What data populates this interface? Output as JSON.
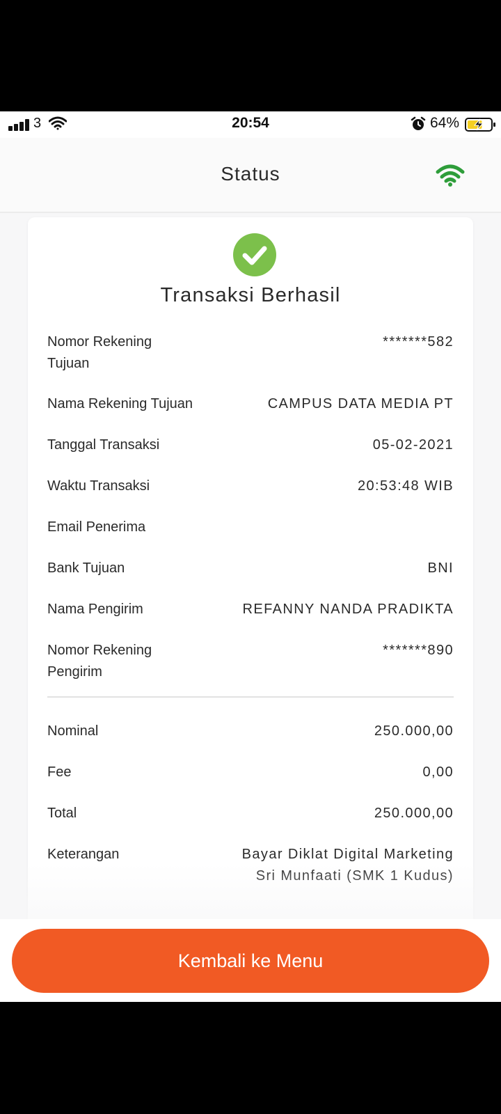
{
  "status_bar": {
    "carrier": "3",
    "time": "20:54",
    "battery_percent": "64%",
    "battery_level": 0.64,
    "signal_icon": "signal-bars-icon",
    "wifi_icon": "wifi-icon",
    "alarm_icon": "alarm-clock-icon",
    "battery_icon": "battery-charging-icon"
  },
  "header": {
    "title": "Status",
    "connection_icon": "wifi-icon",
    "connection_color": "#2e9d3a"
  },
  "card": {
    "status_icon": "check-circle-icon",
    "status_color": "#7cc04b",
    "title": "Transaksi Berhasil",
    "details": [
      {
        "label": "Nomor Rekening Tujuan",
        "value": "*******582"
      },
      {
        "label": "Nama Rekening Tujuan",
        "value": "CAMPUS DATA MEDIA PT"
      },
      {
        "label": "Tanggal Transaksi",
        "value": "05-02-2021"
      },
      {
        "label": "Waktu Transaksi",
        "value": "20:53:48 WIB"
      },
      {
        "label": "Email Penerima",
        "value": ""
      },
      {
        "label": "Bank Tujuan",
        "value": "BNI"
      },
      {
        "label": "Nama Pengirim",
        "value": "REFANNY NANDA PRADIKTA"
      },
      {
        "label": "Nomor Rekening Pengirim",
        "value": "*******890"
      }
    ],
    "amounts": [
      {
        "label": "Nominal",
        "value": "250.000,00"
      },
      {
        "label": "Fee",
        "value": "0,00"
      },
      {
        "label": "Total",
        "value": "250.000,00"
      },
      {
        "label": "Keterangan",
        "value": "Bayar Diklat Digital Marketing Sri Munfaati (SMK 1 Kudus)"
      }
    ]
  },
  "footer": {
    "button_label": "Kembali ke Menu",
    "button_color": "#f15a24"
  }
}
